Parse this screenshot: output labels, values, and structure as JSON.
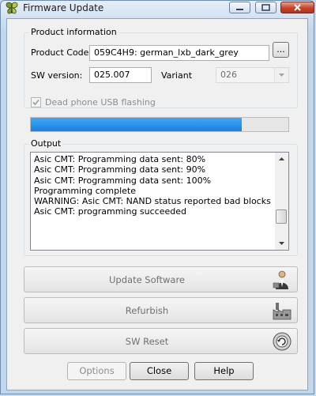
{
  "window": {
    "title": "Firmware Update",
    "icon": "butterfly-app-icon"
  },
  "product_info": {
    "group_label": "Product information",
    "product_code_label": "Product Code:",
    "product_code_value": "059C4H9: german_lxb_dark_grey",
    "browse_label": "...",
    "sw_version_label": "SW version:",
    "sw_version_value": "025.007",
    "variant_label": "Variant",
    "variant_value": "026"
  },
  "dead_phone": {
    "label": "Dead phone USB flashing",
    "checked": true,
    "enabled": false
  },
  "progress": {
    "fraction": 0.82,
    "color": "#1d7fe0"
  },
  "output": {
    "label": "Output",
    "lines": [
      "Asic CMT: Programming data sent: 80%",
      "Asic CMT: Programming data sent: 90%",
      "Asic CMT: Programming data sent: 100%",
      "Programming complete",
      "WARNING:  Asic CMT: NAND status reported bad blocks",
      "Asic CMT: programming succeeded"
    ]
  },
  "actions": {
    "update_software": "Update Software",
    "refurbish": "Refurbish",
    "sw_reset": "SW Reset"
  },
  "footer": {
    "options": "Options",
    "close": "Close",
    "help": "Help"
  }
}
